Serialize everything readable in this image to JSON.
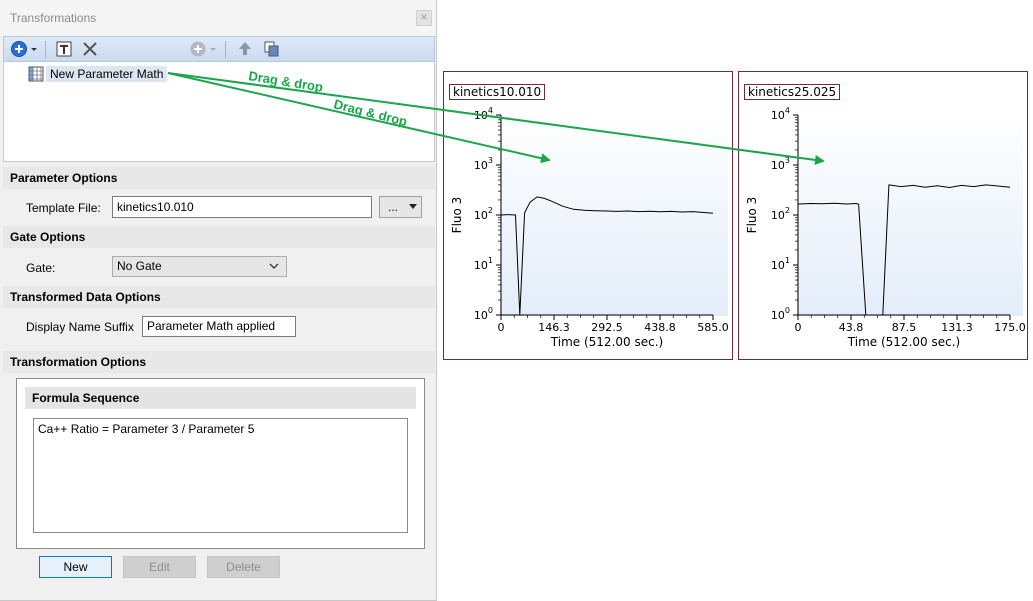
{
  "panel": {
    "title": "Transformations",
    "close_glyph": "⨯",
    "toolbar": {
      "icons": [
        "add-icon",
        "dropdown-icon",
        "template-icon",
        "delete-icon",
        "add-disabled-icon",
        "dropdown-disabled-icon",
        "move-up-icon",
        "copy-icon"
      ]
    },
    "tree": {
      "item_label": "New Parameter Math"
    },
    "parameter_options": {
      "header": "Parameter Options",
      "template_label": "Template File:",
      "template_value": "kinetics10.010",
      "browse_label": "..."
    },
    "gate_options": {
      "header": "Gate Options",
      "gate_label": "Gate:",
      "gate_value": "No Gate"
    },
    "transformed_data_options": {
      "header": "Transformed Data Options",
      "suffix_label": "Display Name Suffix",
      "suffix_value": "Parameter Math applied"
    },
    "transformation_options": {
      "header": "Transformation Options",
      "formula_header": "Formula Sequence",
      "formula_text": "Ca++ Ratio = Parameter 3 / Parameter 5"
    },
    "buttons": {
      "new": "New",
      "edit": "Edit",
      "delete": "Delete"
    }
  },
  "annotations": {
    "drag1": "Drag & drop",
    "drag2": "Drag & drop",
    "color": "#1aa64a"
  },
  "chart_data": [
    {
      "type": "line",
      "title": "kinetics10.010",
      "xlabel": "Time (512.00 sec.)",
      "ylabel": "Fluo 3",
      "x_ticks": [
        "0",
        "146.3",
        "292.5",
        "438.8",
        "585.0"
      ],
      "xlim": [
        0,
        585
      ],
      "y_scale": "log",
      "y_tick_exponents": [
        "0",
        "1",
        "2",
        "3",
        "4"
      ],
      "ylim": [
        1,
        10000
      ],
      "series": [
        {
          "x": [
            0,
            20,
            40,
            52,
            65,
            80,
            100,
            120,
            146,
            170,
            200,
            230,
            260,
            292,
            320,
            350,
            380,
            410,
            438,
            470,
            500,
            530,
            560,
            585
          ],
          "y": [
            100,
            102,
            100,
            1,
            110,
            180,
            230,
            215,
            180,
            150,
            130,
            125,
            122,
            120,
            118,
            120,
            117,
            119,
            116,
            118,
            115,
            117,
            112,
            108
          ]
        }
      ]
    },
    {
      "type": "line",
      "title": "kinetics25.025",
      "xlabel": "Time (512.00 sec.)",
      "ylabel": "Fluo 3",
      "x_ticks": [
        "0",
        "43.8",
        "87.5",
        "131.3",
        "175.0"
      ],
      "xlim": [
        0,
        175
      ],
      "y_scale": "log",
      "y_tick_exponents": [
        "0",
        "1",
        "2",
        "3",
        "4"
      ],
      "ylim": [
        1,
        10000
      ],
      "series": [
        {
          "x": [
            0,
            10,
            20,
            30,
            40,
            48,
            50,
            56,
            70,
            75,
            85,
            95,
            105,
            115,
            125,
            135,
            145,
            155,
            165,
            175
          ],
          "y": [
            165,
            170,
            168,
            172,
            166,
            170,
            165,
            1,
            1,
            400,
            370,
            390,
            360,
            385,
            355,
            390,
            370,
            400,
            380,
            360
          ]
        }
      ]
    }
  ]
}
